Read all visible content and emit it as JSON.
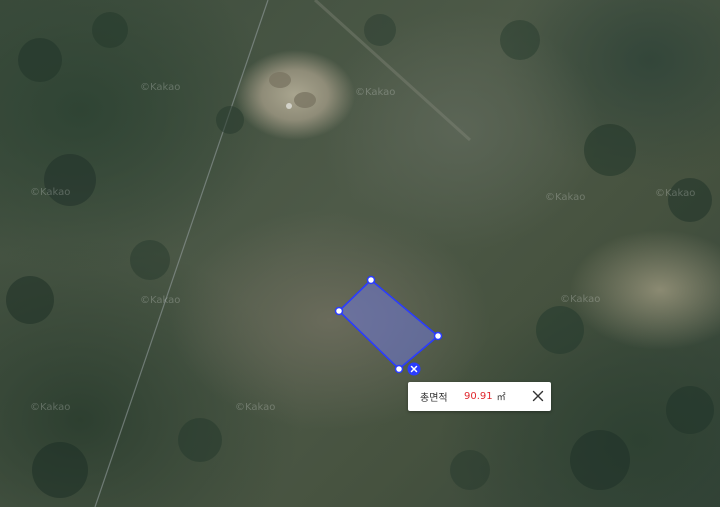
{
  "map": {
    "view": "satellite",
    "watermark": "©Kakao"
  },
  "measurement": {
    "shape": "polygon",
    "vertex_count": 4,
    "stroke_color": "#2a3cff",
    "fill_color": "#6f78d6",
    "tooltip": {
      "label": "총면적",
      "value": "90.91",
      "unit": "㎡",
      "value_color": "#e0282e"
    }
  },
  "icons": {
    "delete_shape": "close-circle-icon",
    "close_tooltip": "close-icon"
  }
}
